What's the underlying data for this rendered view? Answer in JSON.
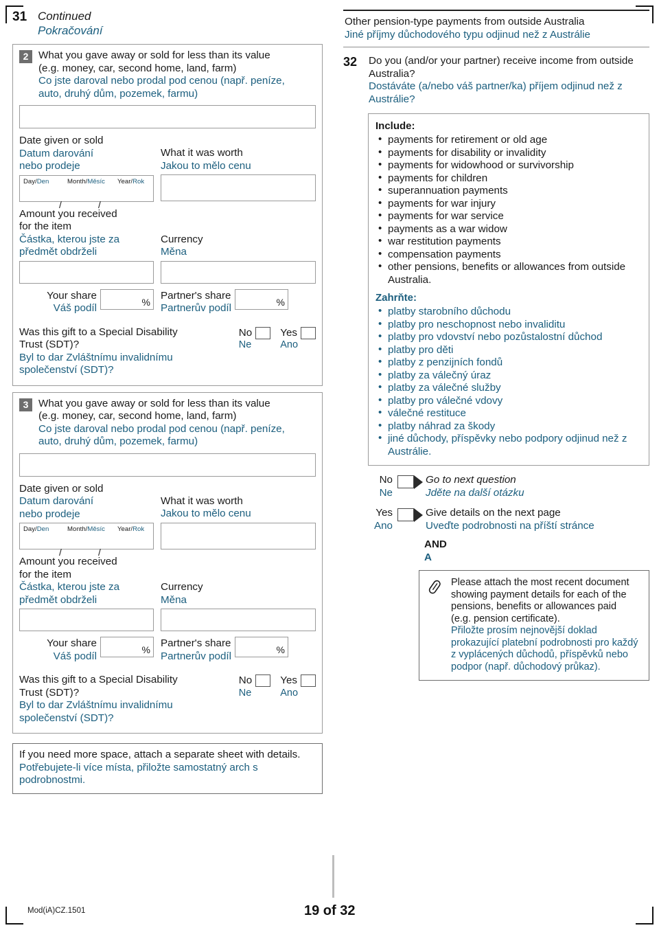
{
  "page": {
    "question_number": "31",
    "continued_en": "Continued",
    "continued_cz": "Pokračování",
    "footer_mod": "Mod(iA)CZ.1501",
    "footer_page": "19 of 32",
    "accent_blue": "#1b5e7e",
    "ink_black": "#1a1a1a",
    "badge_gray": "#6e6e6e"
  },
  "gift_item_labels": {
    "what_en_l1": "What you gave away or sold for less than its value",
    "what_en_l2": "(e.g. money, car, second home, land, farm)",
    "what_cz_l1": "Co jste daroval nebo prodal pod cenou (např. peníze,",
    "what_cz_l2": "auto, druhý dům, pozemek, farmu)",
    "date_en_l1": "Date given or sold",
    "date_cz_l1": "Datum darování",
    "date_cz_l2": "nebo prodeje",
    "day": "Day/",
    "day_cz": "Den",
    "month": "Month/",
    "month_cz": "Měsíc",
    "year": "Year/",
    "year_cz": "Rok",
    "slash1": "/",
    "slash2": "/",
    "worth_en": "What it was worth",
    "worth_cz": "Jakou to mělo cenu",
    "amount_en_l1": "Amount you received",
    "amount_en_l2": "for the item",
    "amount_cz_l1": "Částka, kterou jste za",
    "amount_cz_l2": "předmět obdrželi",
    "currency_en": "Currency",
    "currency_cz": "Měna",
    "your_share_en": "Your share",
    "your_share_cz": "Váš podíl",
    "partner_share_en": "Partner's share",
    "partner_share_cz": "Partnerův podíl",
    "percent": "%",
    "sdt_en_l1": "Was this gift to a Special Disability",
    "sdt_en_l2": "Trust (SDT)?",
    "sdt_cz_l1": "Byl to dar Zvláštnímu invalidnímu",
    "sdt_cz_l2": "společenství (SDT)?",
    "no_en": "No",
    "no_cz": "Ne",
    "yes_en": "Yes",
    "yes_cz": "Ano"
  },
  "items": [
    {
      "badge": "2"
    },
    {
      "badge": "3"
    }
  ],
  "more_space_note": {
    "en": "If you need more space, attach a separate sheet with details.",
    "cz_l1": "Potřebujete-li více místa, přiložte samostatný arch s",
    "cz_l2": "podrobnostmi."
  },
  "right": {
    "section_title_en": "Other pension-type payments from outside Australia",
    "section_title_cz": "Jiné příjmy důchodového typu odjinud než z Austrálie",
    "q_number": "32",
    "q_en_l1": "Do you (and/or your partner) receive income from outside",
    "q_en_l2": "Australia?",
    "q_cz_l1": "Dostáváte (a/nebo váš partner/ka) příjem odjinud než z",
    "q_cz_l2": "Austrálie?",
    "include_en_header": "Include:",
    "include_en_items": [
      "payments for retirement or old age",
      "payments for disability or invalidity",
      "payments for widowhood or survivorship",
      "payments for children",
      "superannuation payments",
      "payments for war injury",
      "payments for war service",
      "payments as a war widow",
      "war restitution payments",
      "compensation payments",
      "other pensions, benefits or allowances from outside Australia."
    ],
    "include_cz_header": "Zahrňte:",
    "include_cz_items": [
      "platby starobního důchodu",
      "platby pro neschopnost nebo invaliditu",
      "platby pro vdovství nebo pozůstalostní důchod",
      "platby pro děti",
      "platby z penzijních fondů",
      "platby za válečný úraz",
      "platby za válečné služby",
      "platby pro válečné vdovy",
      "válečné restituce",
      "platby náhrad za škody",
      "jiné důchody, příspěvky nebo podpory odjinud než z Austrálie."
    ],
    "no_en": "No",
    "no_cz": "Ne",
    "no_action_en": "Go to next question",
    "no_action_cz": "Jděte na další otázku",
    "yes_en": "Yes",
    "yes_cz": "Ano",
    "yes_action_en": "Give details on the next page",
    "yes_action_cz": "Uveďte podrobnosti na příští stránce",
    "and_en": "AND",
    "and_cz": "A",
    "attach_en_l1": "Please attach the most recent document",
    "attach_en_l2": "showing payment details for each of the",
    "attach_en_l3": "pensions, benefits or allowances paid",
    "attach_en_l4": "(e.g. pension certificate).",
    "attach_cz_l1": "Přiložte prosím nejnovější doklad",
    "attach_cz_l2": "prokazující platební podrobnosti pro každý",
    "attach_cz_l3": "z vyplácených důchodů, příspěvků nebo",
    "attach_cz_l4": "podpor (např. důchodový průkaz)."
  }
}
